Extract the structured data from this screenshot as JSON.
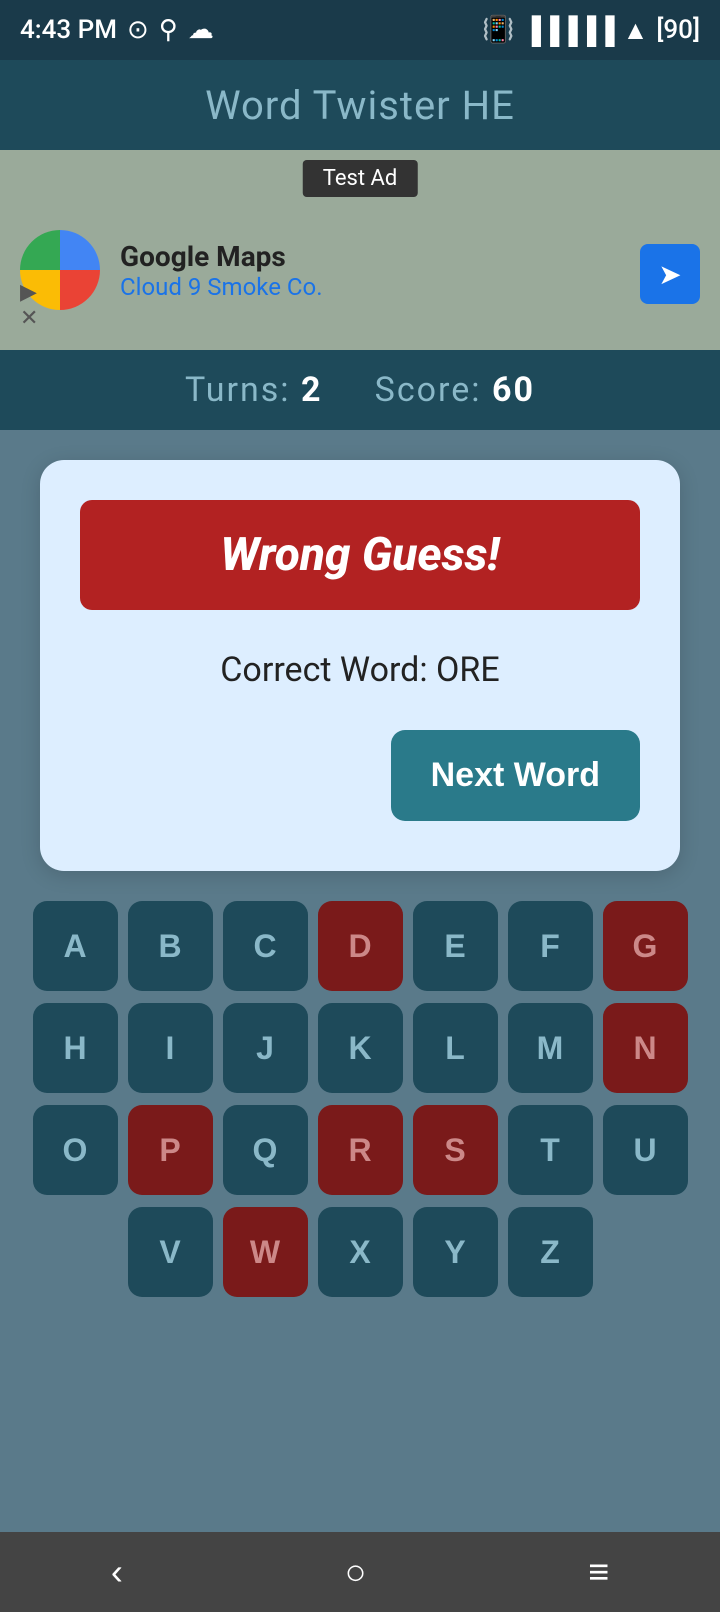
{
  "statusBar": {
    "time": "4:43 PM",
    "battery": "90"
  },
  "appTitle": "Word Twister HE",
  "ad": {
    "testLabel": "Test Ad",
    "companyName": "Google Maps",
    "subText": "Cloud 9 Smoke Co.",
    "playIcon": "▶",
    "closeIcon": "✕",
    "navArrow": "➤"
  },
  "score": {
    "turnsLabel": "Turns:",
    "turnsValue": "2",
    "scoreLabel": "Score:",
    "scoreValue": "60"
  },
  "resultCard": {
    "wrongGuessLabel": "Wrong Guess!",
    "correctWordLabel": "Correct Word: ORE",
    "nextWordLabel": "Next Word"
  },
  "keyboard": {
    "rows": [
      [
        {
          "letter": "A",
          "used": false
        },
        {
          "letter": "B",
          "used": false
        },
        {
          "letter": "C",
          "used": false
        },
        {
          "letter": "D",
          "used": true
        },
        {
          "letter": "E",
          "used": false
        },
        {
          "letter": "F",
          "used": false
        },
        {
          "letter": "G",
          "used": true
        }
      ],
      [
        {
          "letter": "H",
          "used": false
        },
        {
          "letter": "I",
          "used": false
        },
        {
          "letter": "J",
          "used": false
        },
        {
          "letter": "K",
          "used": false
        },
        {
          "letter": "L",
          "used": false
        },
        {
          "letter": "M",
          "used": false
        },
        {
          "letter": "N",
          "used": true
        }
      ],
      [
        {
          "letter": "O",
          "used": false
        },
        {
          "letter": "P",
          "used": true
        },
        {
          "letter": "Q",
          "used": false
        },
        {
          "letter": "R",
          "used": true
        },
        {
          "letter": "S",
          "used": true
        },
        {
          "letter": "T",
          "used": false
        },
        {
          "letter": "U",
          "used": false
        }
      ],
      [
        {
          "letter": "V",
          "used": false
        },
        {
          "letter": "W",
          "used": true
        },
        {
          "letter": "X",
          "used": false
        },
        {
          "letter": "Y",
          "used": false
        },
        {
          "letter": "Z",
          "used": false
        }
      ]
    ]
  },
  "navBar": {
    "backLabel": "‹",
    "homeLabel": "○",
    "menuLabel": "≡"
  }
}
